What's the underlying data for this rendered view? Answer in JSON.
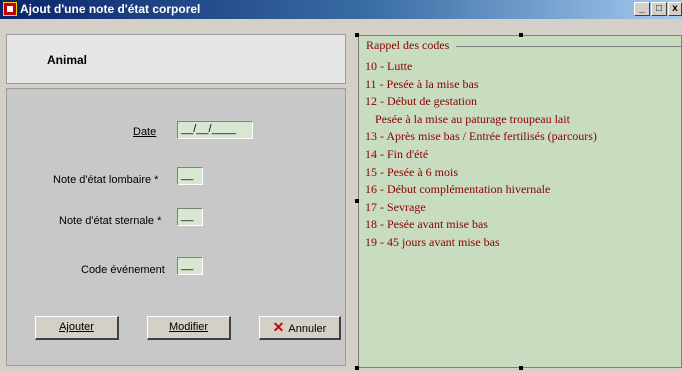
{
  "window": {
    "title": "Ajout d'une note d'état corporel",
    "controls": {
      "minimize": "_",
      "maximize": "□",
      "close": "x"
    }
  },
  "animal": {
    "label": "Animal"
  },
  "form": {
    "date": {
      "label": "Date",
      "value": "__/__/____"
    },
    "lumbar": {
      "label": "Note d'état lombaire *",
      "value": "__"
    },
    "sternal": {
      "label": "Note d'état sternale *",
      "value": "__"
    },
    "event": {
      "label": "Code événement",
      "value": "__"
    }
  },
  "buttons": {
    "add": "Ajouter",
    "modify": "Modifier",
    "cancel": "Annuler"
  },
  "codes": {
    "legend": "Rappel des codes",
    "items": [
      "10 - Lutte",
      "11 - Pesée à la mise bas",
      "12 - Début de gestation",
      "Pesée à la mise au paturage troupeau lait",
      "13 - Après mise bas / Entrée fertilisés (parcours)",
      "14 - Fin d'été",
      "15 - Pesée à 6 mois",
      "16 - Début complémentation hivernale",
      "17 - Sevrage",
      "18 - Pesée avant mise bas",
      "19 - 45 jours avant mise bas"
    ]
  }
}
